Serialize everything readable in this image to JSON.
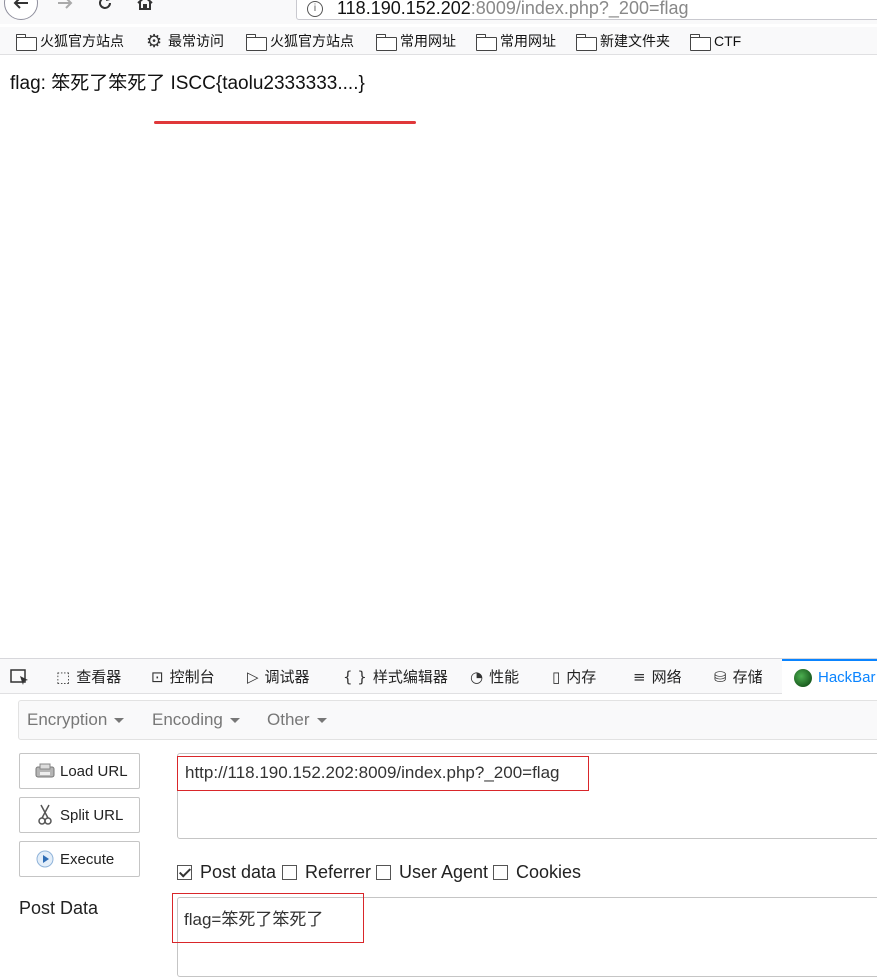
{
  "browser": {
    "url_host": "118.190.152.202",
    "url_rest": ":8009/index.php?_200=flag"
  },
  "bookmarks": [
    {
      "label": "火狐官方站点",
      "icon": "folder-icon"
    },
    {
      "label": "最常访问",
      "icon": "gear-icon"
    },
    {
      "label": "火狐官方站点",
      "icon": "folder-icon"
    },
    {
      "label": "常用网址",
      "icon": "folder-icon"
    },
    {
      "label": "常用网址",
      "icon": "folder-icon"
    },
    {
      "label": "新建文件夹",
      "icon": "folder-icon"
    },
    {
      "label": "CTF",
      "icon": "folder-icon"
    }
  ],
  "page": {
    "text": "flag: 笨死了笨死了 ISCC{taolu2333333....}"
  },
  "devtools": {
    "tabs": [
      {
        "label": "查看器",
        "icon": "inspector-icon"
      },
      {
        "label": "控制台",
        "icon": "console-icon"
      },
      {
        "label": "调试器",
        "icon": "debugger-icon"
      },
      {
        "label": "样式编辑器",
        "icon": "style-editor-icon"
      },
      {
        "label": "性能",
        "icon": "performance-icon"
      },
      {
        "label": "内存",
        "icon": "memory-icon"
      },
      {
        "label": "网络",
        "icon": "network-icon"
      },
      {
        "label": "存储",
        "icon": "storage-icon"
      },
      {
        "label": "HackBar",
        "icon": "hackbar-icon"
      }
    ],
    "active_tab": "HackBar",
    "accent": "#0a84ff"
  },
  "hackbar": {
    "menu": [
      "Encryption",
      "Encoding",
      "Other"
    ],
    "buttons": {
      "load_url": "Load URL",
      "split_url": "Split URL",
      "execute": "Execute"
    },
    "url_value": "http://118.190.152.202:8009/index.php?_200=flag",
    "checkboxes": [
      {
        "label": "Post data",
        "checked": true
      },
      {
        "label": "Referrer",
        "checked": false
      },
      {
        "label": "User Agent",
        "checked": false
      },
      {
        "label": "Cookies",
        "checked": false
      }
    ],
    "post_label": "Post Data",
    "post_value": "flag=笨死了笨死了",
    "highlight_color": "#d9262a"
  }
}
